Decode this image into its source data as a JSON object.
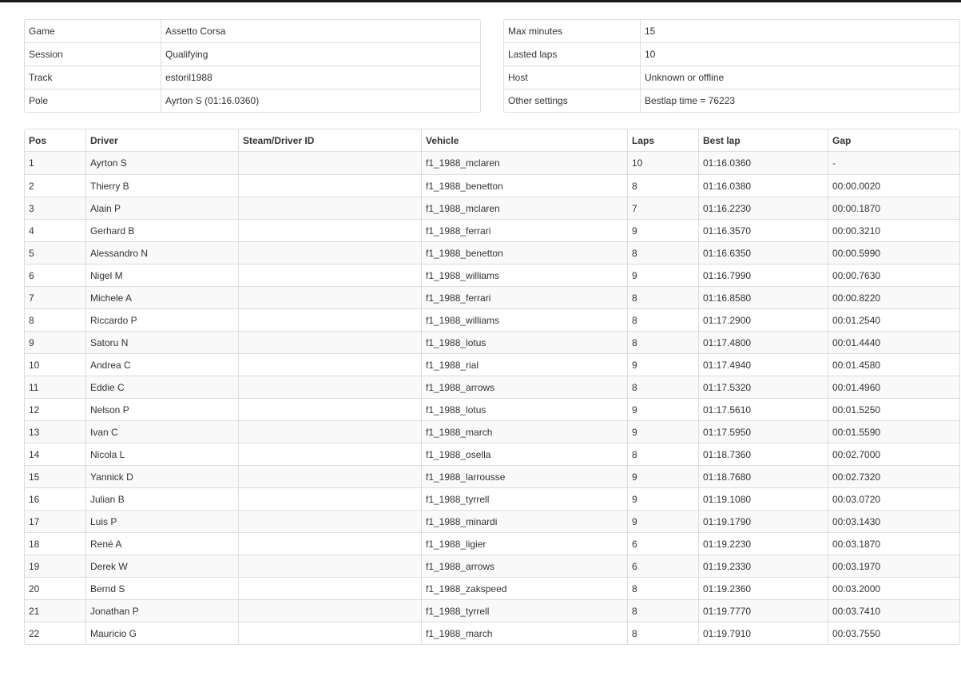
{
  "session_info": {
    "left": [
      {
        "label": "Game",
        "value": "Assetto Corsa"
      },
      {
        "label": "Session",
        "value": "Qualifying"
      },
      {
        "label": "Track",
        "value": "estoril1988"
      },
      {
        "label": "Pole",
        "value": "Ayrton S (01:16.0360)"
      }
    ],
    "right": [
      {
        "label": "Max minutes",
        "value": "15"
      },
      {
        "label": "Lasted laps",
        "value": "10"
      },
      {
        "label": "Host",
        "value": "Unknown or offline"
      },
      {
        "label": "Other settings",
        "value": "Bestlap time = 76223"
      }
    ]
  },
  "results": {
    "headers": [
      "Pos",
      "Driver",
      "Steam/Driver ID",
      "Vehicle",
      "Laps",
      "Best lap",
      "Gap"
    ],
    "rows": [
      {
        "pos": "1",
        "driver": "Ayrton S",
        "id": "",
        "vehicle": "f1_1988_mclaren",
        "laps": "10",
        "best": "01:16.0360",
        "gap": "-"
      },
      {
        "pos": "2",
        "driver": "Thierry B",
        "id": "",
        "vehicle": "f1_1988_benetton",
        "laps": "8",
        "best": "01:16.0380",
        "gap": "00:00.0020"
      },
      {
        "pos": "3",
        "driver": "Alain P",
        "id": "",
        "vehicle": "f1_1988_mclaren",
        "laps": "7",
        "best": "01:16.2230",
        "gap": "00:00.1870"
      },
      {
        "pos": "4",
        "driver": "Gerhard B",
        "id": "",
        "vehicle": "f1_1988_ferrari",
        "laps": "9",
        "best": "01:16.3570",
        "gap": "00:00.3210"
      },
      {
        "pos": "5",
        "driver": "Alessandro N",
        "id": "",
        "vehicle": "f1_1988_benetton",
        "laps": "8",
        "best": "01:16.6350",
        "gap": "00:00.5990"
      },
      {
        "pos": "6",
        "driver": "Nigel M",
        "id": "",
        "vehicle": "f1_1988_williams",
        "laps": "9",
        "best": "01:16.7990",
        "gap": "00:00.7630"
      },
      {
        "pos": "7",
        "driver": "Michele A",
        "id": "",
        "vehicle": "f1_1988_ferrari",
        "laps": "8",
        "best": "01:16.8580",
        "gap": "00:00.8220"
      },
      {
        "pos": "8",
        "driver": "Riccardo P",
        "id": "",
        "vehicle": "f1_1988_williams",
        "laps": "8",
        "best": "01:17.2900",
        "gap": "00:01.2540"
      },
      {
        "pos": "9",
        "driver": "Satoru N",
        "id": "",
        "vehicle": "f1_1988_lotus",
        "laps": "8",
        "best": "01:17.4800",
        "gap": "00:01.4440"
      },
      {
        "pos": "10",
        "driver": "Andrea C",
        "id": "",
        "vehicle": "f1_1988_rial",
        "laps": "9",
        "best": "01:17.4940",
        "gap": "00:01.4580"
      },
      {
        "pos": "11",
        "driver": "Eddie C",
        "id": "",
        "vehicle": "f1_1988_arrows",
        "laps": "8",
        "best": "01:17.5320",
        "gap": "00:01.4960"
      },
      {
        "pos": "12",
        "driver": "Nelson P",
        "id": "",
        "vehicle": "f1_1988_lotus",
        "laps": "9",
        "best": "01:17.5610",
        "gap": "00:01.5250"
      },
      {
        "pos": "13",
        "driver": "Ivan C",
        "id": "",
        "vehicle": "f1_1988_march",
        "laps": "9",
        "best": "01:17.5950",
        "gap": "00:01.5590"
      },
      {
        "pos": "14",
        "driver": "Nicola L",
        "id": "",
        "vehicle": "f1_1988_osella",
        "laps": "8",
        "best": "01:18.7360",
        "gap": "00:02.7000"
      },
      {
        "pos": "15",
        "driver": "Yannick D",
        "id": "",
        "vehicle": "f1_1988_larrousse",
        "laps": "9",
        "best": "01:18.7680",
        "gap": "00:02.7320"
      },
      {
        "pos": "16",
        "driver": "Julian B",
        "id": "",
        "vehicle": "f1_1988_tyrrell",
        "laps": "9",
        "best": "01:19.1080",
        "gap": "00:03.0720"
      },
      {
        "pos": "17",
        "driver": "Luis P",
        "id": "",
        "vehicle": "f1_1988_minardi",
        "laps": "9",
        "best": "01:19.1790",
        "gap": "00:03.1430"
      },
      {
        "pos": "18",
        "driver": "René A",
        "id": "",
        "vehicle": "f1_1988_ligier",
        "laps": "6",
        "best": "01:19.2230",
        "gap": "00:03.1870"
      },
      {
        "pos": "19",
        "driver": "Derek W",
        "id": "",
        "vehicle": "f1_1988_arrows",
        "laps": "6",
        "best": "01:19.2330",
        "gap": "00:03.1970"
      },
      {
        "pos": "20",
        "driver": "Bernd S",
        "id": "",
        "vehicle": "f1_1988_zakspeed",
        "laps": "8",
        "best": "01:19.2360",
        "gap": "00:03.2000"
      },
      {
        "pos": "21",
        "driver": "Jonathan P",
        "id": "",
        "vehicle": "f1_1988_tyrrell",
        "laps": "8",
        "best": "01:19.7770",
        "gap": "00:03.7410"
      },
      {
        "pos": "22",
        "driver": "Mauricio G",
        "id": "",
        "vehicle": "f1_1988_march",
        "laps": "8",
        "best": "01:19.7910",
        "gap": "00:03.7550"
      }
    ]
  }
}
